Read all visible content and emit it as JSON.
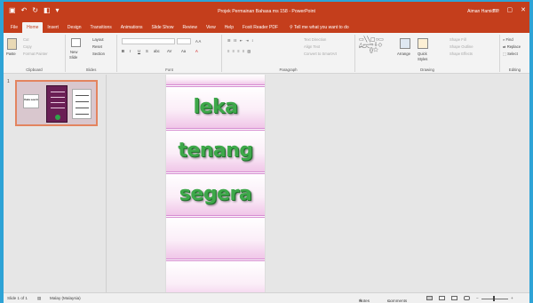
{
  "titlebar": {
    "doc_title": "Projek Permainan Bahasa ms 158 - PowerPoint",
    "user": "Aiman Hamidter",
    "qa_icons": [
      "save-icon",
      "undo-icon",
      "redo-icon",
      "present-icon",
      "dropdown-icon"
    ],
    "minimize": "—",
    "restore": "▢",
    "close": "✕"
  },
  "tabs": [
    "File",
    "Home",
    "Insert",
    "Design",
    "Transitions",
    "Animations",
    "Slide Show",
    "Review",
    "View",
    "Help",
    "Foxit Reader PDF"
  ],
  "active_tab": "Home",
  "tell_me": "Tell me what you want to do",
  "ribbon": {
    "clipboard": {
      "label": "Clipboard",
      "paste": "Paste",
      "cut": "Cut",
      "copy": "Copy",
      "format_painter": "Format Painter"
    },
    "slides": {
      "label": "Slides",
      "new_slide": "New",
      "new_slide2": "Slide",
      "layout": "Layout",
      "reset": "Reset",
      "section": "Section"
    },
    "font": {
      "label": "Font",
      "bold": "B",
      "italic": "I",
      "underline": "U",
      "strike": "S",
      "shadow": "abc",
      "spacing": "AV",
      "case": "Aa",
      "color": "A"
    },
    "paragraph": {
      "label": "Paragraph",
      "text_direction": "Text Direction",
      "align_text": "Align Text",
      "smartart": "Convert to SmartArt"
    },
    "drawing": {
      "label": "Drawing",
      "arrange": "Arrange",
      "quick_styles": "Quick",
      "quick_styles2": "Styles",
      "shape_fill": "Shape Fill",
      "shape_outline": "Shape Outline",
      "shape_effects": "Shape Effects"
    },
    "editing": {
      "label": "Editing",
      "find": "Find",
      "replace": "Replace",
      "select": "Select"
    }
  },
  "thumbnail": {
    "number": "1",
    "left_box": "Kata seerti",
    "right_lines": 4
  },
  "slide_words": [
    "leka",
    "tenang",
    "segera"
  ],
  "status": {
    "slide_count": "Slide 1 of 1",
    "language": "Malay (Malaysia)",
    "notes": "Notes",
    "comments": "Comments"
  }
}
